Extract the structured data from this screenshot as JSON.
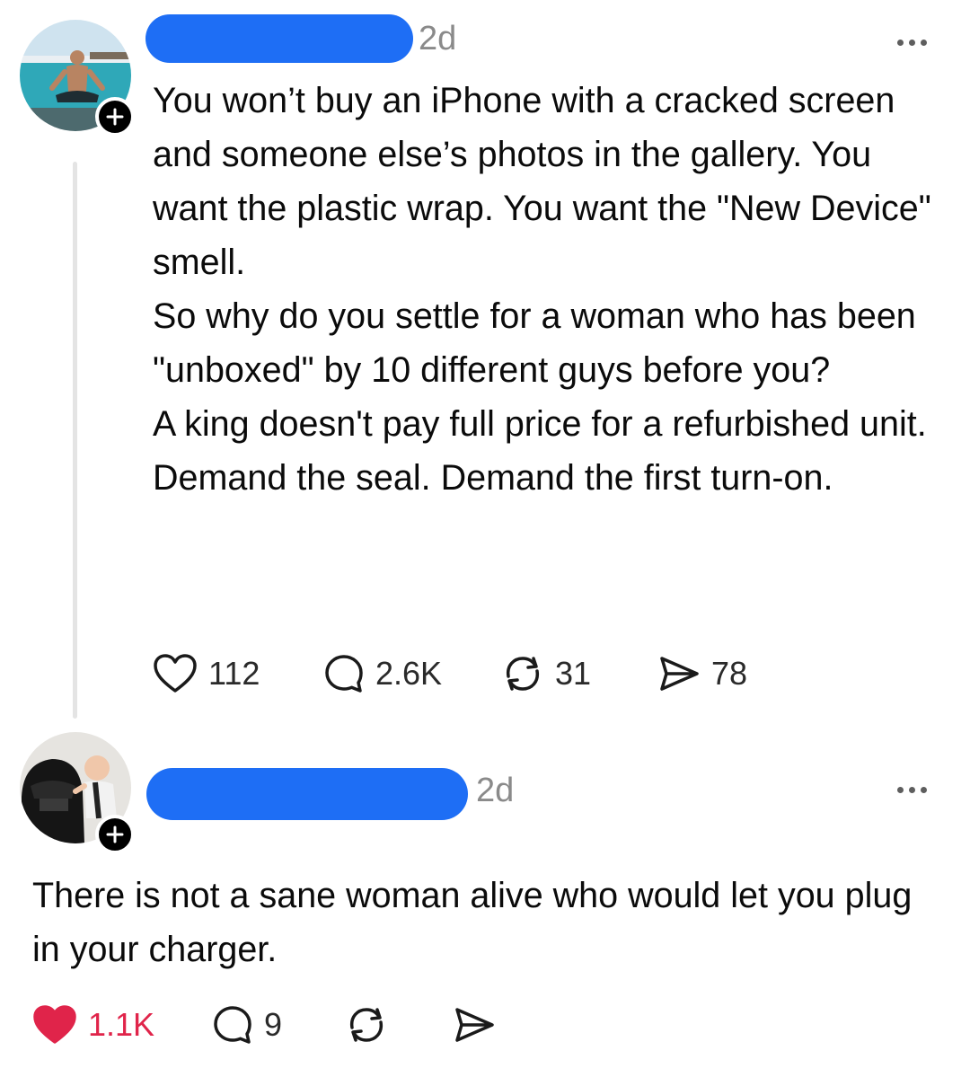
{
  "posts": [
    {
      "timestamp": "2d",
      "body": [
        "You won’t buy an iPhone with a cracked screen and someone else’s photos in the gallery. You want the plastic wrap. You want the \"New Device\" smell.",
        "So why do you settle for a woman who has been \"unboxed\" by 10 different guys before you?",
        "A king doesn't pay full price for a refurbished unit.",
        "Demand the seal. Demand the first turn-on."
      ],
      "actions": {
        "likes": "112",
        "replies": "2.6K",
        "reposts": "31",
        "shares": "78",
        "liked": false
      },
      "icons": {
        "avatar": "avatar-meditating-man-beach",
        "follow": "plus-icon",
        "more": "more-dots-icon"
      }
    },
    {
      "timestamp": "2d",
      "body": [
        "There is not a sane woman alive who would let you plug in your charger."
      ],
      "actions": {
        "likes": "1.1K",
        "replies": "9",
        "reposts": "",
        "shares": "",
        "liked": true
      },
      "icons": {
        "avatar": "avatar-vader-with-baby",
        "follow": "plus-icon",
        "more": "more-dots-icon"
      }
    }
  ],
  "colors": {
    "redaction": "#1e6ef5",
    "like_active": "#e0244a",
    "muted_text": "#8a8a8a",
    "thread_line": "#e4e4e4"
  }
}
